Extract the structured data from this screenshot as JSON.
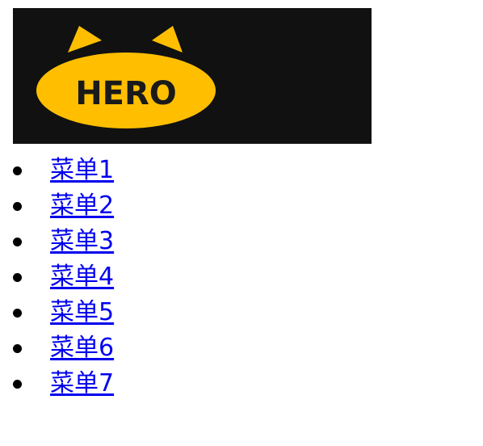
{
  "logo": {
    "text": "HERO",
    "colors": {
      "background": "#111111",
      "head": "#ffbf00",
      "text": "#1a1a1a"
    }
  },
  "menu": {
    "link_color": "#0000ee",
    "items": [
      {
        "label": "菜单1"
      },
      {
        "label": "菜单2"
      },
      {
        "label": "菜单3"
      },
      {
        "label": "菜单4"
      },
      {
        "label": "菜单5"
      },
      {
        "label": "菜单6"
      },
      {
        "label": "菜单7"
      }
    ]
  }
}
